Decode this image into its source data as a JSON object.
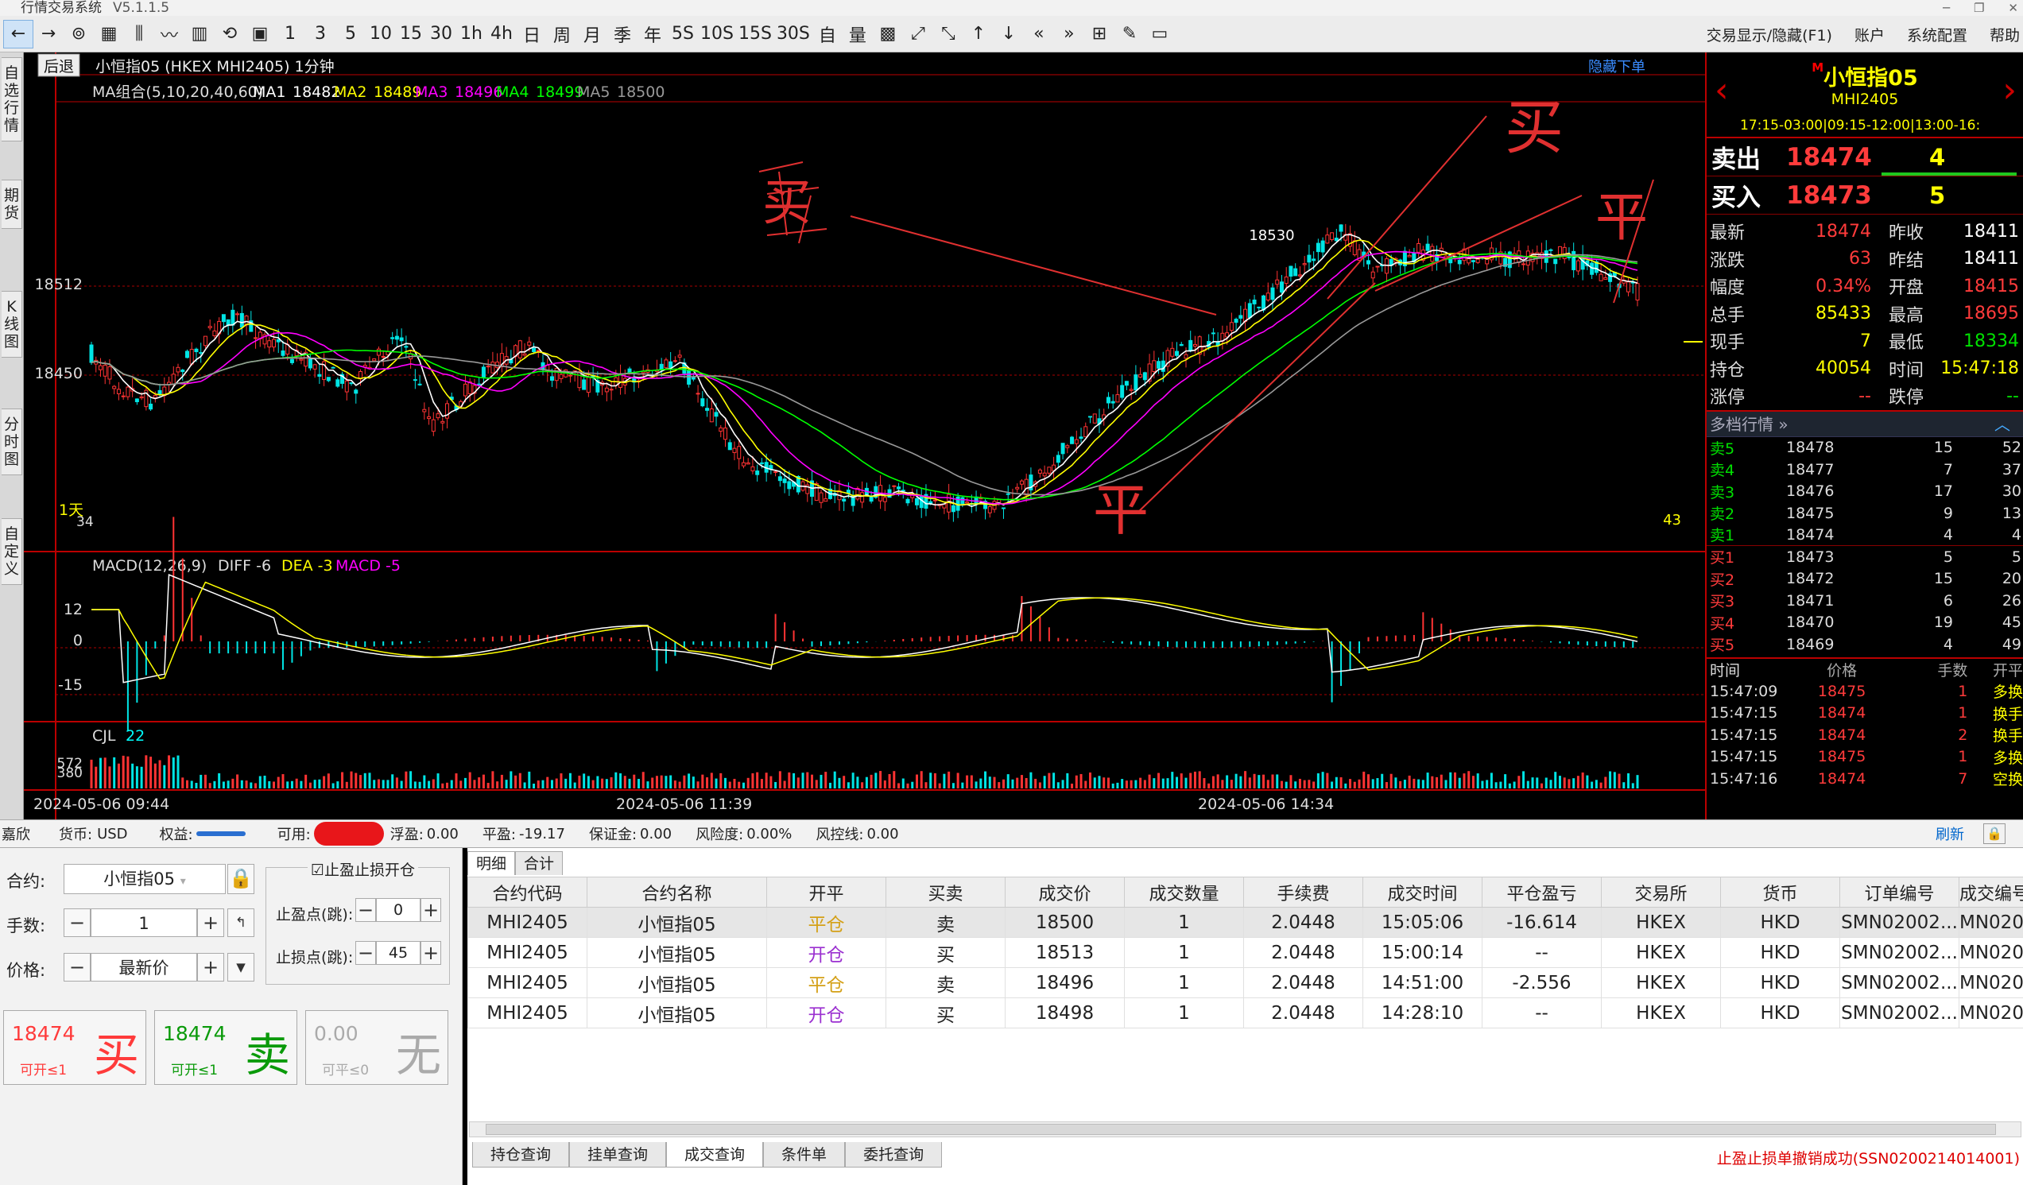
{
  "window": {
    "title": "行情交易系统",
    "version": "V5.1.1.5"
  },
  "toolbar": {
    "items": [
      "←",
      "→",
      "⊚",
      "▦",
      "⫼",
      "〰",
      "▥",
      "⟲",
      "▣",
      "1",
      "3",
      "5",
      "10",
      "15",
      "30",
      "1h",
      "4h",
      "日",
      "周",
      "月",
      "季",
      "年",
      "5S",
      "10S",
      "15S",
      "30S",
      "自",
      "量",
      "▩",
      "⤢",
      "⤡",
      "↑",
      "↓",
      "«",
      "»",
      "⊞",
      "✎",
      "▭"
    ],
    "right": [
      "交易显示/隐藏(F1)",
      "账户",
      "系统配置",
      "帮助"
    ]
  },
  "lefttabs": [
    "自选行情",
    "期货",
    "K线图",
    "分时图",
    "自定义"
  ],
  "chart": {
    "header": "小恒指05 (HKEX MHI2405) 1分钟",
    "back_btn": "后退",
    "hide_link": "隐藏下单",
    "ma_title": "MA组合(5,10,20,40,60)",
    "ma": [
      {
        "name": "MA1",
        "value": "18482",
        "color": "#ffffff"
      },
      {
        "name": "MA2",
        "value": "18489",
        "color": "#ffff00"
      },
      {
        "name": "MA3",
        "value": "18496",
        "color": "#ff00ff"
      },
      {
        "name": "MA4",
        "value": "18499",
        "color": "#00ff00"
      },
      {
        "name": "MA5",
        "value": "18500",
        "color": "#999999"
      }
    ],
    "price_labels": [
      "18512",
      "18450"
    ],
    "peak_label": "18530",
    "corner_left": "1天",
    "corner_left2": "34",
    "corner_right": "43",
    "macd_title": "MACD(12,26,9)",
    "macd_diff": "DIFF -6",
    "macd_dea": "DEA -3",
    "macd_macd": "MACD -5",
    "macd_labels": [
      "12",
      "0",
      "-15"
    ],
    "cjl_title": "CJL",
    "cjl_value": "22",
    "cjl_labels": [
      "572",
      "380"
    ],
    "time_labels": [
      "2024-05-06 09:44",
      "2024-05-06 11:39",
      "2024-05-06 14:34"
    ],
    "annotations": [
      "买",
      "买",
      "平",
      "平"
    ]
  },
  "quote": {
    "name": "小恒指05",
    "badge": "M",
    "code": "MHI2405",
    "hours": "17:15-03:00|09:15-12:00|13:00-16:",
    "sell": {
      "label": "卖出",
      "price": "18474",
      "vol": "4"
    },
    "buy": {
      "label": "买入",
      "price": "18473",
      "vol": "5"
    },
    "stats": [
      {
        "k": "最新",
        "v": "18474",
        "vc": "red",
        "k2": "昨收",
        "v2": "18411",
        "v2c": "white"
      },
      {
        "k": "涨跌",
        "v": "63",
        "vc": "red",
        "k2": "昨结",
        "v2": "18411",
        "v2c": "white"
      },
      {
        "k": "幅度",
        "v": "0.34%",
        "vc": "red",
        "k2": "开盘",
        "v2": "18415",
        "v2c": "red"
      },
      {
        "k": "总手",
        "v": "85433",
        "vc": "yellow",
        "k2": "最高",
        "v2": "18695",
        "v2c": "red"
      },
      {
        "k": "现手",
        "v": "7",
        "vc": "yellow",
        "k2": "最低",
        "v2": "18334",
        "v2c": "green"
      },
      {
        "k": "持仓",
        "v": "40054",
        "vc": "yellow",
        "k2": "时间",
        "v2": "15:47:18",
        "v2c": "yellow"
      },
      {
        "k": "涨停",
        "v": "--",
        "vc": "red",
        "k2": "跌停",
        "v2": "--",
        "v2c": "green"
      }
    ],
    "depth_title": "多档行情",
    "asks": [
      {
        "l": "卖5",
        "p": "18478",
        "q": "15",
        "q2": "52"
      },
      {
        "l": "卖4",
        "p": "18477",
        "q": "7",
        "q2": "37"
      },
      {
        "l": "卖3",
        "p": "18476",
        "q": "17",
        "q2": "30"
      },
      {
        "l": "卖2",
        "p": "18475",
        "q": "9",
        "q2": "13"
      },
      {
        "l": "卖1",
        "p": "18474",
        "q": "4",
        "q2": "4"
      }
    ],
    "bids": [
      {
        "l": "买1",
        "p": "18473",
        "q": "5",
        "q2": "5"
      },
      {
        "l": "买2",
        "p": "18472",
        "q": "15",
        "q2": "20"
      },
      {
        "l": "买3",
        "p": "18471",
        "q": "6",
        "q2": "26"
      },
      {
        "l": "买4",
        "p": "18470",
        "q": "19",
        "q2": "45"
      },
      {
        "l": "买5",
        "p": "18469",
        "q": "4",
        "q2": "49"
      }
    ],
    "tick_header": {
      "t": "时间",
      "p": "价格",
      "n": "手数",
      "o": "开平"
    },
    "ticks": [
      {
        "t": "15:47:09",
        "p": "18475",
        "n": "1",
        "o": "多换"
      },
      {
        "t": "15:47:15",
        "p": "18474",
        "n": "1",
        "o": "换手"
      },
      {
        "t": "15:47:15",
        "p": "18474",
        "n": "2",
        "o": "换手"
      },
      {
        "t": "15:47:15",
        "p": "18475",
        "n": "1",
        "o": "多换"
      },
      {
        "t": "15:47:16",
        "p": "18474",
        "n": "7",
        "o": "空换"
      }
    ]
  },
  "account": {
    "user": "嘉欣",
    "currency_label": "货币:",
    "currency": "USD",
    "equity_label": "权益:",
    "avail_label": "可用:",
    "float_label": "浮盈:",
    "float": "0.00",
    "close_label": "平盈:",
    "close": "-19.17",
    "margin_label": "保证金:",
    "margin": "0.00",
    "risk_label": "风险度:",
    "risk": "0.00%",
    "riskline_label": "风控线:",
    "riskline": "0.00",
    "refresh": "刷新"
  },
  "order": {
    "contract_label": "合约:",
    "contract": "小恒指05",
    "qty_label": "手数:",
    "qty": "1",
    "price_label": "价格:",
    "price": "最新价",
    "stop_title": "止盈止损开仓",
    "tp_label": "止盈点(跳):",
    "tp": "0",
    "sl_label": "止损点(跳):",
    "sl": "45",
    "buy_btn": {
      "price": "18474",
      "sub": "可开≤1",
      "char": "买"
    },
    "sell_btn": {
      "price": "18474",
      "sub": "可开≤1",
      "char": "卖"
    },
    "none_btn": {
      "price": "0.00",
      "sub": "可平≤0",
      "char": "无"
    }
  },
  "grid": {
    "tabs": [
      "明细",
      "合计"
    ],
    "columns": [
      "合约代码",
      "合约名称",
      "开平",
      "买卖",
      "成交价",
      "成交数量",
      "手续费",
      "成交时间",
      "平仓盈亏",
      "交易所",
      "货币",
      "订单编号",
      "成交编号"
    ],
    "rows": [
      {
        "code": "MHI2405",
        "name": "小恒指05",
        "oc": "平仓",
        "bs": "卖",
        "price": "18500",
        "qty": "1",
        "fee": "2.0448",
        "time": "15:05:06",
        "pnl": "-16.614",
        "ex": "HKEX",
        "cur": "HKD",
        "order": "SMN02002...",
        "trade": "MN0200"
      },
      {
        "code": "MHI2405",
        "name": "小恒指05",
        "oc": "开仓",
        "bs": "买",
        "price": "18513",
        "qty": "1",
        "fee": "2.0448",
        "time": "15:00:14",
        "pnl": "--",
        "ex": "HKEX",
        "cur": "HKD",
        "order": "SMN02002...",
        "trade": "MN0200"
      },
      {
        "code": "MHI2405",
        "name": "小恒指05",
        "oc": "平仓",
        "bs": "卖",
        "price": "18496",
        "qty": "1",
        "fee": "2.0448",
        "time": "14:51:00",
        "pnl": "-2.556",
        "ex": "HKEX",
        "cur": "HKD",
        "order": "SMN02002...",
        "trade": "MN0200"
      },
      {
        "code": "MHI2405",
        "name": "小恒指05",
        "oc": "开仓",
        "bs": "买",
        "price": "18498",
        "qty": "1",
        "fee": "2.0448",
        "time": "14:28:10",
        "pnl": "--",
        "ex": "HKEX",
        "cur": "HKD",
        "order": "SMN02002...",
        "trade": "MN0200"
      }
    ],
    "bottom_tabs": [
      "持仓查询",
      "挂单查询",
      "成交查询",
      "条件单",
      "委托查询"
    ],
    "status": "止盈止损单撤销成功(SSN0200214014001)"
  }
}
